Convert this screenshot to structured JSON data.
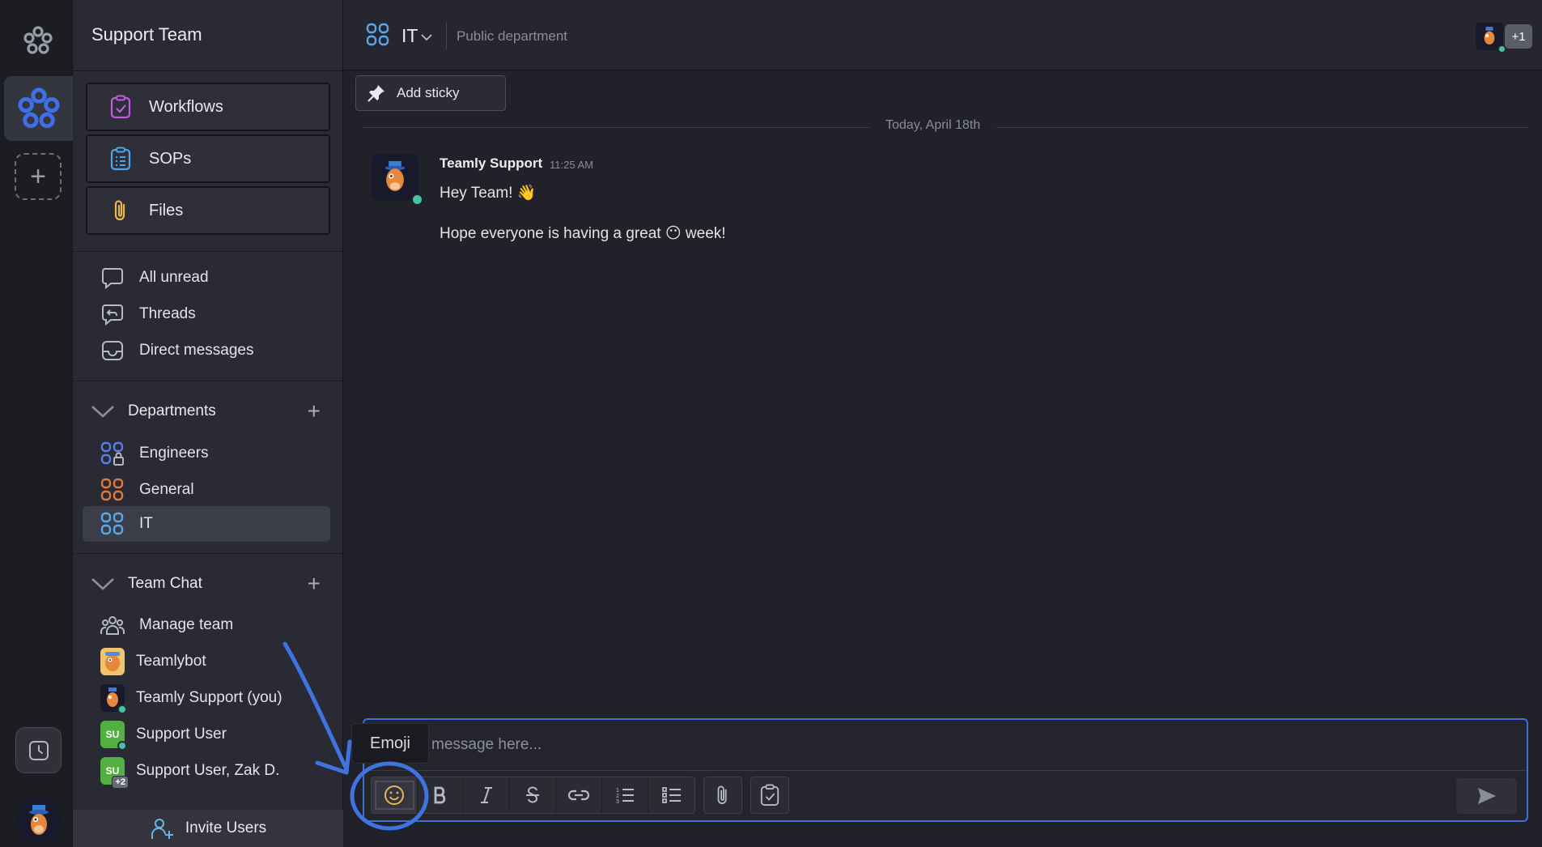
{
  "workspace": {
    "name": "Support Team"
  },
  "sidebar": {
    "big_buttons": [
      {
        "label": "Workflows",
        "icon": "workflow-icon",
        "color": "#c25be0"
      },
      {
        "label": "SOPs",
        "icon": "clipboard-list-icon",
        "color": "#4aa8ea"
      },
      {
        "label": "Files",
        "icon": "paperclip-icon",
        "color": "#e8b64a"
      }
    ],
    "nav": [
      {
        "label": "All unread",
        "icon": "chat-bubble-icon"
      },
      {
        "label": "Threads",
        "icon": "threads-icon"
      },
      {
        "label": "Direct messages",
        "icon": "inbox-icon"
      }
    ],
    "departments": {
      "title": "Departments",
      "items": [
        {
          "label": "Engineers",
          "icon": "department-locked-icon",
          "color": "#5b7de8"
        },
        {
          "label": "General",
          "icon": "department-icon",
          "color": "#e07a3a"
        },
        {
          "label": "IT",
          "icon": "department-icon",
          "color": "#5aa8e8",
          "active": true
        }
      ]
    },
    "team_chat": {
      "title": "Team Chat",
      "items": [
        {
          "label": "Manage team",
          "icon": "people-icon"
        },
        {
          "label": "Teamlybot",
          "avatar": "bot-avatar"
        },
        {
          "label": "Teamly Support (you)",
          "avatar": "support-avatar"
        },
        {
          "label": "Support User",
          "avatar_text": "SU"
        },
        {
          "label": "Support User, Zak D.",
          "avatar_text": "SU",
          "extra": "+2"
        }
      ]
    },
    "invite_label": "Invite Users"
  },
  "channel": {
    "name": "IT",
    "description": "Public department",
    "member_extra": "+1"
  },
  "actions": {
    "add_sticky": "Add sticky"
  },
  "messages": {
    "date_divider": "Today, April 18th",
    "items": [
      {
        "author": "Teamly Support",
        "time": "11:25 AM",
        "line1": "Hey Team! 👋",
        "line2": "Hope everyone is having a great 😶 week!"
      }
    ]
  },
  "composer": {
    "placeholder": "Type a message here...",
    "visible_placeholder": "message here...",
    "tooltip": "Emoji",
    "tools": [
      "emoji-icon",
      "bold-icon",
      "italic-icon",
      "strikethrough-icon",
      "link-icon",
      "ordered-list-icon",
      "bullet-list-icon",
      "attach-icon",
      "task-icon"
    ]
  },
  "colors": {
    "accent": "#3d6fd8",
    "online": "#4bc0a8",
    "annotation": "#3f74e0"
  }
}
